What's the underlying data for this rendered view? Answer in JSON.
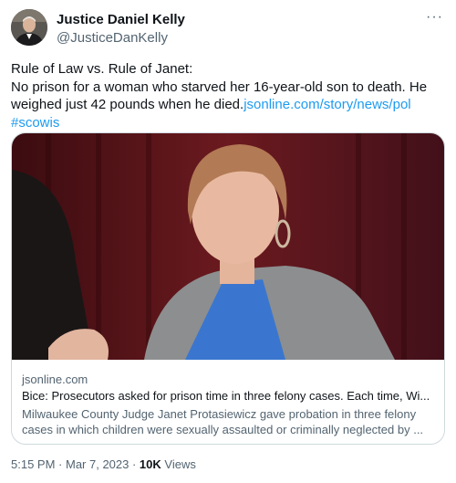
{
  "author": {
    "display_name": "Justice Daniel Kelly",
    "handle": "@JusticeDanKelly"
  },
  "more_label": "···",
  "tweet": {
    "line1": "Rule of Law vs. Rule of Janet:",
    "line2": "No prison for a woman who starved her 16-year-old son to death. He weighed just 42 pounds when he died.",
    "link_text": "jsonline.com/story/news/pol",
    "hashtag": "#scowis"
  },
  "card": {
    "domain": "jsonline.com",
    "title": "Bice: Prosecutors asked for prison time in three felony cases. Each time, Wi...",
    "description": "Milwaukee County Judge Janet Protasiewicz gave probation in three felony cases in which children were sexually assaulted or criminally neglected by ..."
  },
  "meta": {
    "time": "5:15 PM",
    "date": "Mar 7, 2023",
    "views_count": "10K",
    "views_label": "Views"
  },
  "colors": {
    "link": "#1d9bf0",
    "secondary_text": "#536471",
    "primary_text": "#0f1419",
    "card_border": "#cfd9de"
  }
}
